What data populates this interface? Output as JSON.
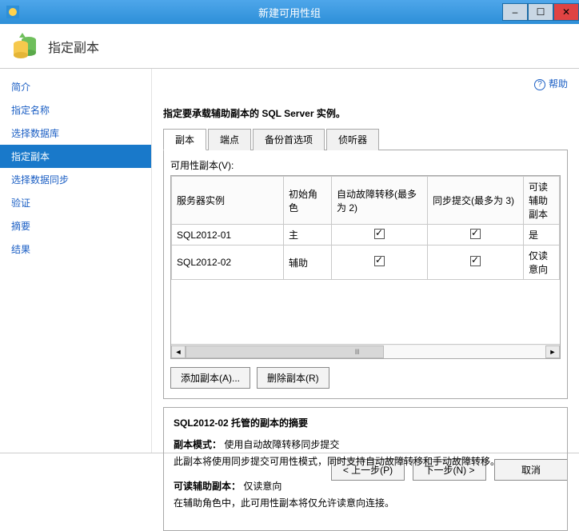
{
  "window": {
    "title": "新建可用性组",
    "minimize": "–",
    "maximize": "☐",
    "close": "✕"
  },
  "header": {
    "heading": "指定副本"
  },
  "nav": {
    "items": [
      {
        "label": "简介"
      },
      {
        "label": "指定名称"
      },
      {
        "label": "选择数据库"
      },
      {
        "label": "指定副本"
      },
      {
        "label": "选择数据同步"
      },
      {
        "label": "验证"
      },
      {
        "label": "摘要"
      },
      {
        "label": "结果"
      }
    ],
    "active_index": 3
  },
  "help": {
    "label": "帮助"
  },
  "instruction": "指定要承载辅助副本的 SQL Server 实例。",
  "tabs": {
    "items": [
      {
        "label": "副本"
      },
      {
        "label": "端点"
      },
      {
        "label": "备份首选项"
      },
      {
        "label": "侦听器"
      }
    ],
    "active_index": 0
  },
  "replica_panel": {
    "sublabel": "可用性副本(V):",
    "columns": [
      "服务器实例",
      "初始角色",
      "自动故障转移(最多为 2)",
      "同步提交(最多为 3)",
      "可读辅助副本"
    ],
    "rows": [
      {
        "server": "SQL2012-01",
        "role": "主",
        "auto_failover": true,
        "sync_commit": true,
        "readable": "是"
      },
      {
        "server": "SQL2012-02",
        "role": "辅助",
        "auto_failover": true,
        "sync_commit": true,
        "readable": "仅读意向"
      }
    ],
    "add_btn": "添加副本(A)...",
    "remove_btn": "删除副本(R)"
  },
  "summary": {
    "title": "SQL2012-02 托管的副本的摘要",
    "mode_label": "副本模式：",
    "mode_value": "使用自动故障转移同步提交",
    "mode_desc": "此副本将使用同步提交可用性模式，同时支持自动故障转移和手动故障转移。",
    "readable_label": "可读辅助副本：",
    "readable_value": "仅读意向",
    "readable_desc": "在辅助角色中，此可用性副本将仅允许读意向连接。"
  },
  "footer": {
    "prev": "< 上一步(P)",
    "next": "下一步(N) >",
    "cancel": "取消"
  }
}
